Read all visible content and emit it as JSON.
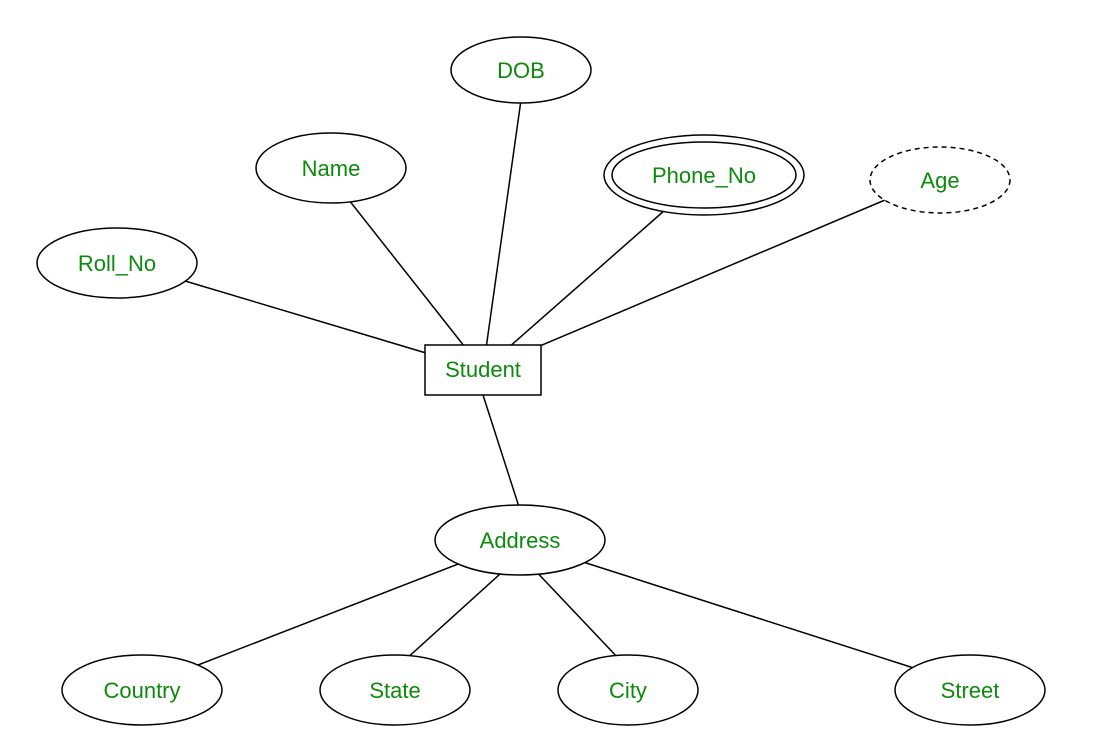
{
  "entity": {
    "label": "Student"
  },
  "attributes": {
    "roll_no": {
      "label": "Roll_No"
    },
    "name": {
      "label": "Name"
    },
    "dob": {
      "label": "DOB"
    },
    "phone_no": {
      "label": "Phone_No"
    },
    "age": {
      "label": "Age"
    },
    "address": {
      "label": "Address"
    }
  },
  "address_parts": {
    "country": {
      "label": "Country"
    },
    "state": {
      "label": "State"
    },
    "city": {
      "label": "City"
    },
    "street": {
      "label": "Street"
    }
  }
}
